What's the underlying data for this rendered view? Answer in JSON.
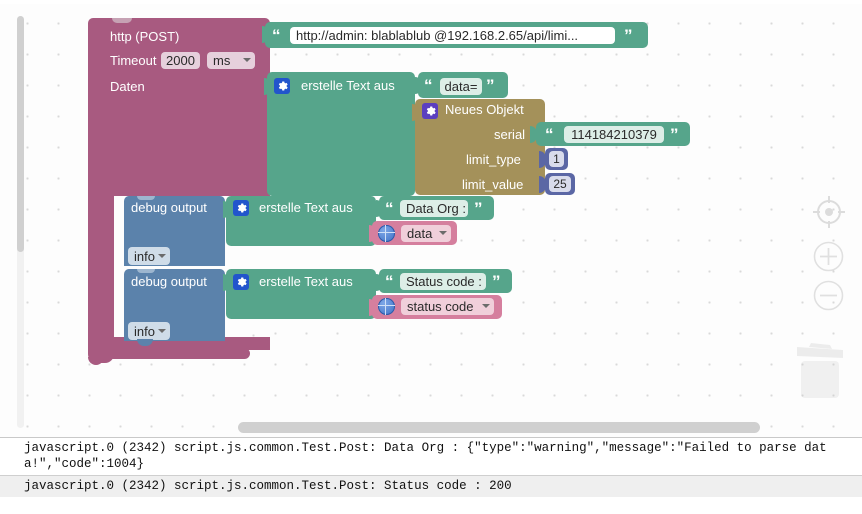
{
  "app": {
    "name": "Blockly script editor",
    "colors": {
      "http_block": "#a85a80",
      "text_join_block": "#56a58b",
      "object_block": "#a4915a",
      "debug_block": "#5b82ab",
      "number_block": "#5b67a5",
      "variable_block": "#d57f9e",
      "gear_icon": "#2255cc"
    }
  },
  "workspace": {
    "http_block": {
      "title": "http (POST)",
      "timeout_label": "Timeout",
      "timeout_value": "2000",
      "timeout_unit": "ms",
      "data_label": "Daten",
      "url_value": "http://admin:  blablablub      @192.168.2.65/api/limi..."
    },
    "text_join_data": {
      "label": "erstelle Text aus",
      "gear_icon": "gear-icon",
      "item_1": "data="
    },
    "new_object": {
      "label": "Neues Objekt",
      "gear_icon": "gear-icon",
      "fields": [
        {
          "key": "serial",
          "value": "114184210379",
          "kind": "text"
        },
        {
          "key": "limit_type",
          "value": "1",
          "kind": "number"
        },
        {
          "key": "limit_value",
          "value": "25",
          "kind": "number"
        }
      ]
    },
    "debug_1": {
      "label": "debug output",
      "level": "info",
      "text_join_label": "erstelle Text aus",
      "gear_icon": "gear-icon",
      "string_item": "Data Org : ",
      "variable_item": "data",
      "variable_icon": "globe-icon"
    },
    "debug_2": {
      "label": "debug output",
      "level": "info",
      "text_join_label": "erstelle Text aus",
      "gear_icon": "gear-icon",
      "string_item": "Status code : ",
      "variable_item": "status code",
      "variable_icon": "globe-icon"
    },
    "controls": {
      "center": "target-center-icon",
      "zoom_in": "plus-icon",
      "zoom_out": "minus-icon",
      "trash": "trash-icon"
    },
    "scrollbars": {
      "vertical": "vertical-scrollbar",
      "horizontal": "horizontal-scrollbar"
    }
  },
  "console": {
    "lines": [
      "javascript.0 (2342) script.js.common.Test.Post: Data Org : {\"type\":\"warning\",\"message\":\"Failed to parse data!\",\"code\":1004}",
      "javascript.0 (2342) script.js.common.Test.Post: Status code : 200"
    ]
  }
}
